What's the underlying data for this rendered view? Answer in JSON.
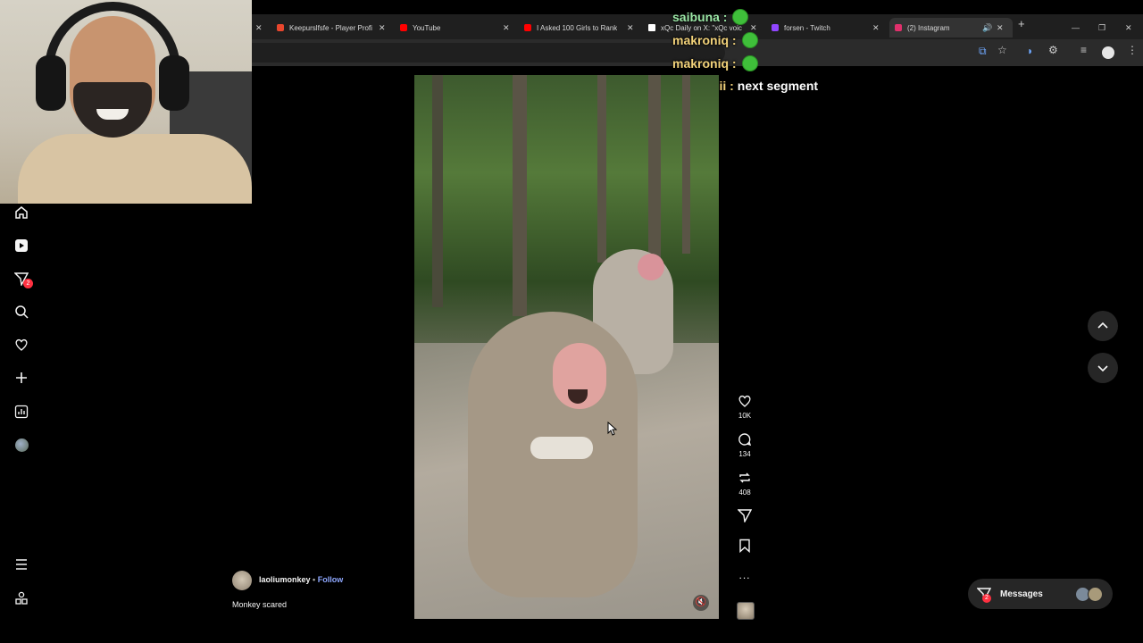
{
  "browser": {
    "tabs": [
      {
        "label": "Keepurslfsfe - Player Profi",
        "favicon_color": "#e8462d"
      },
      {
        "label": "YouTube",
        "favicon_color": "#ff0000"
      },
      {
        "label": "I Asked 100 Girls to Rank",
        "favicon_color": "#ff0000"
      },
      {
        "label": "xQc Daily on X: \"xQc voic",
        "favicon_color": "#ffffff"
      },
      {
        "label": "forsen - Twitch",
        "favicon_color": "#9146ff"
      },
      {
        "label": "(2) Instagram",
        "favicon_color": "#e1306c",
        "active": true
      }
    ]
  },
  "chat_overlay": [
    {
      "user": "saibuna :",
      "message": "",
      "color": "#9be7a6"
    },
    {
      "user": "makroniq :",
      "message": "",
      "color": "#f2d27a"
    },
    {
      "user": "makroniq :",
      "message": "",
      "color": "#f2d27a"
    },
    {
      "user": "soonii :",
      "message": "next segment",
      "color": "#f2d27a"
    }
  ],
  "sidebar": {
    "items": [
      "home-icon",
      "reels-icon",
      "send-icon",
      "search-icon",
      "heart-icon",
      "create-icon",
      "insights-icon",
      "profile-avatar"
    ],
    "notification_badge": "2",
    "bottom": [
      "menu-icon",
      "more-icon"
    ]
  },
  "reel": {
    "username": "laoliumonkey",
    "separator": "•",
    "follow_label": "Follow",
    "caption": "Monkey scared",
    "likes": "10K",
    "comments": "134",
    "reposts": "408",
    "more_label": "..."
  },
  "messages": {
    "label": "Messages",
    "badge": "2"
  },
  "colors": {
    "follow": "#8fa8ff",
    "badge": "#ff3040",
    "background": "#000000"
  }
}
